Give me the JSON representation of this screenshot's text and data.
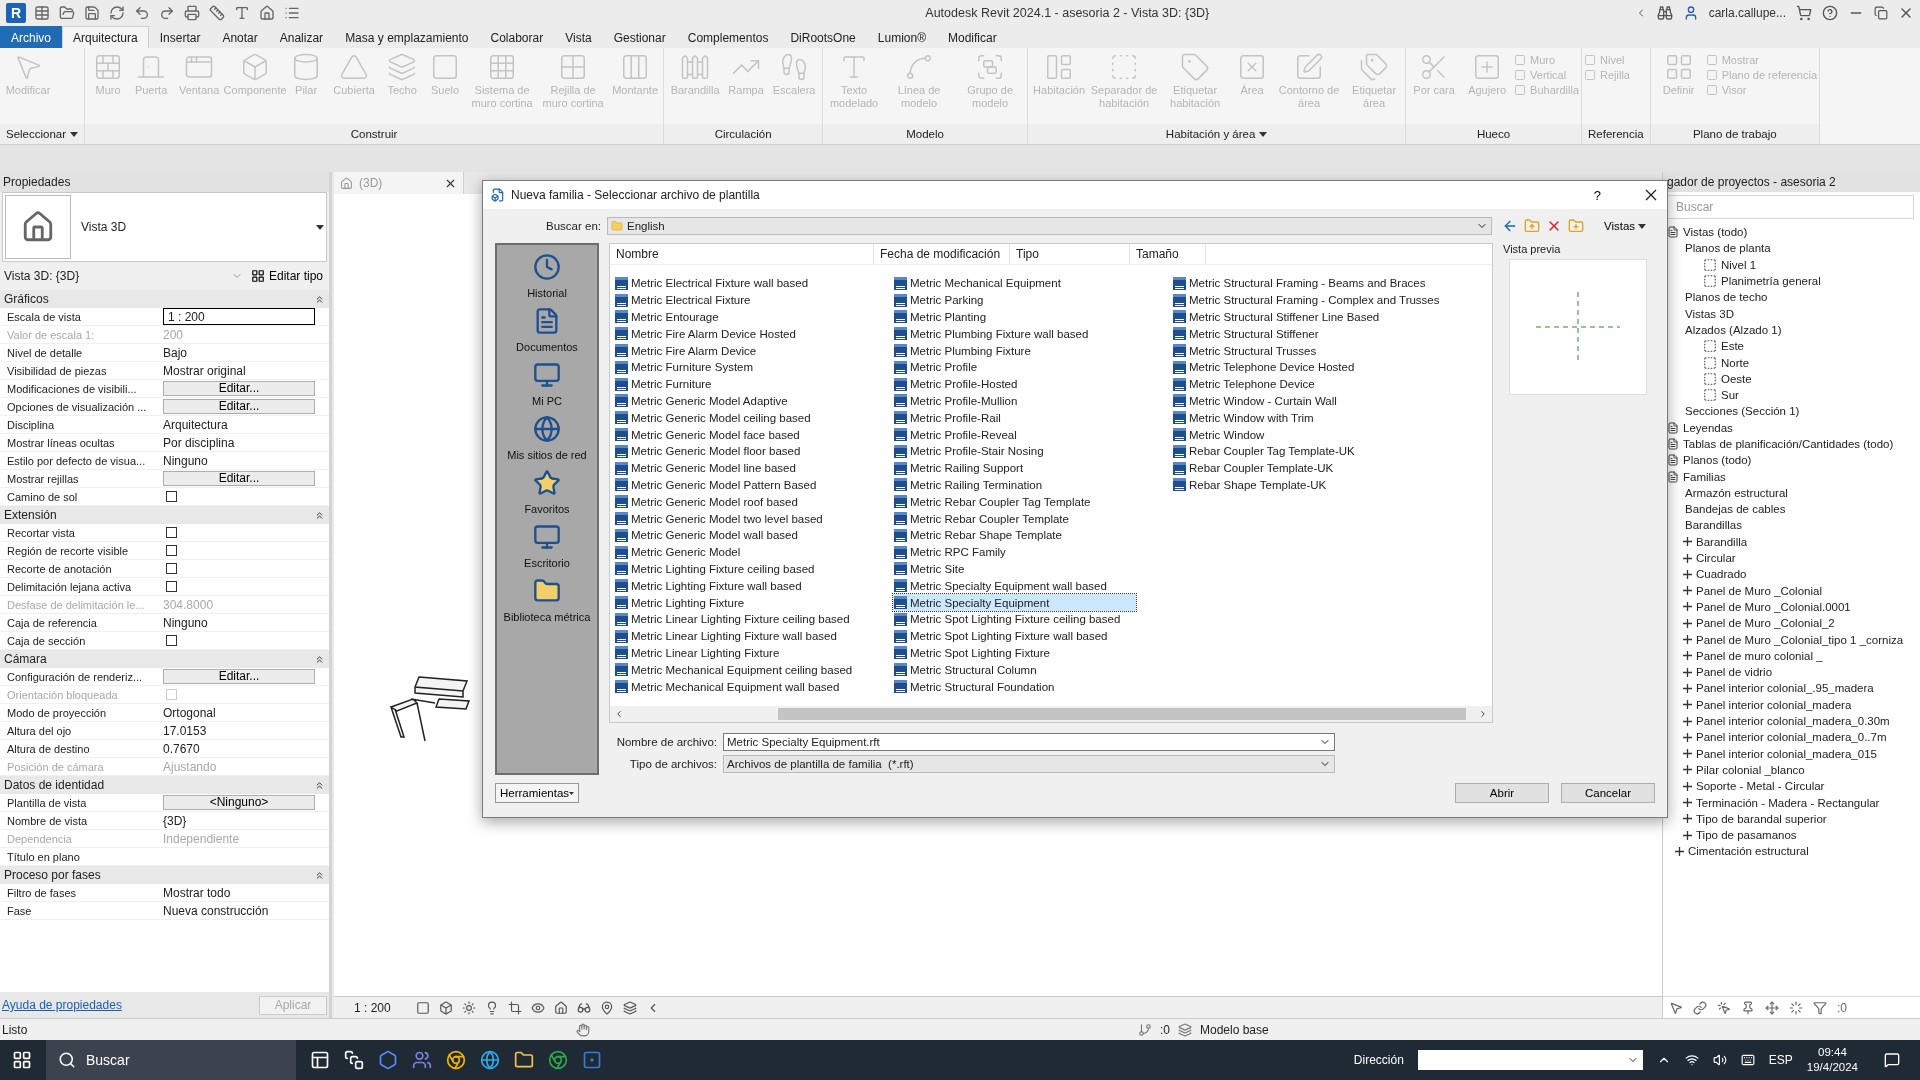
{
  "app": {
    "logo": "R",
    "title": "Autodesk Revit 2024.1 - asesoria 2 - Vista 3D: {3D}",
    "user": "carla.callupe..."
  },
  "menu": [
    {
      "label": "Archivo",
      "kind": "file",
      "selected": false
    },
    {
      "label": "Arquitectura",
      "kind": "tab",
      "selected": true
    },
    {
      "label": "Insertar",
      "kind": "tab",
      "selected": false
    },
    {
      "label": "Anotar",
      "kind": "tab",
      "selected": false
    },
    {
      "label": "Analizar",
      "kind": "tab",
      "selected": false
    },
    {
      "label": "Masa y emplazamiento",
      "kind": "tab",
      "selected": false
    },
    {
      "label": "Colaborar",
      "kind": "tab",
      "selected": false
    },
    {
      "label": "Vista",
      "kind": "tab",
      "selected": false
    },
    {
      "label": "Gestionar",
      "kind": "tab",
      "selected": false
    },
    {
      "label": "Complementos",
      "kind": "tab",
      "selected": false
    },
    {
      "label": "DiRootsOne",
      "kind": "tab",
      "selected": false
    },
    {
      "label": "Lumion®",
      "kind": "tab",
      "selected": false
    },
    {
      "label": "Modificar",
      "kind": "tab",
      "selected": false
    }
  ],
  "ribbon": [
    {
      "label": "Seleccionar",
      "has_menu": true,
      "tools": [
        {
          "kind": "large",
          "label": "Modificar",
          "disabled": true
        }
      ]
    },
    {
      "label": "Construir",
      "has_menu": false,
      "tools": [
        {
          "kind": "large",
          "label": "Muro",
          "disabled": true
        },
        {
          "kind": "large",
          "label": "Puerta",
          "disabled": true
        },
        {
          "kind": "large",
          "label": "Ventana",
          "disabled": true
        },
        {
          "kind": "large",
          "label": "Componente",
          "disabled": true
        },
        {
          "kind": "large",
          "label": "Pilar",
          "disabled": true
        },
        {
          "kind": "large",
          "label": "Cubierta",
          "disabled": true
        },
        {
          "kind": "large",
          "label": "Techo",
          "disabled": true
        },
        {
          "kind": "large",
          "label": "Suelo",
          "disabled": true
        },
        {
          "kind": "large",
          "label": "Sistema de muro cortina",
          "disabled": true
        },
        {
          "kind": "large",
          "label": "Rejilla de muro cortina",
          "disabled": true
        },
        {
          "kind": "large",
          "label": "Montante",
          "disabled": true
        }
      ]
    },
    {
      "label": "Circulación",
      "has_menu": false,
      "tools": [
        {
          "kind": "large",
          "label": "Barandilla",
          "disabled": true
        },
        {
          "kind": "large",
          "label": "Rampa",
          "disabled": true
        },
        {
          "kind": "large",
          "label": "Escalera",
          "disabled": true
        }
      ]
    },
    {
      "label": "Modelo",
      "has_menu": false,
      "tools": [
        {
          "kind": "large",
          "label": "Texto modelado",
          "disabled": true
        },
        {
          "kind": "large",
          "label": "Línea de modelo",
          "disabled": true
        },
        {
          "kind": "large",
          "label": "Grupo de modelo",
          "disabled": true
        }
      ]
    },
    {
      "label": "Habitación y área",
      "has_menu": true,
      "tools": [
        {
          "kind": "large",
          "label": "Habitación",
          "disabled": true
        },
        {
          "kind": "large",
          "label": "Separador de habitación",
          "disabled": true
        },
        {
          "kind": "large",
          "label": "Etiquetar habitación",
          "disabled": true
        },
        {
          "kind": "large",
          "label": "Área",
          "disabled": true
        },
        {
          "kind": "large",
          "label": "Contorno de área",
          "disabled": true
        },
        {
          "kind": "large",
          "label": "Etiquetar área",
          "disabled": true
        }
      ]
    },
    {
      "label": "Hueco",
      "has_menu": false,
      "tools": [
        {
          "kind": "large",
          "label": "Por cara",
          "disabled": true
        },
        {
          "kind": "large",
          "label": "Agujero",
          "disabled": true
        },
        {
          "kind": "stack",
          "items": [
            {
              "label": "Muro",
              "disabled": true
            },
            {
              "label": "Vertical",
              "disabled": true
            },
            {
              "label": "Buhardilla",
              "disabled": true
            }
          ]
        }
      ]
    },
    {
      "label": "Referencia",
      "has_menu": false,
      "tools": [
        {
          "kind": "stack",
          "items": [
            {
              "label": "Nivel",
              "disabled": true
            },
            {
              "label": "Rejilla",
              "disabled": true
            }
          ]
        }
      ]
    },
    {
      "label": "Plano de trabajo",
      "has_menu": false,
      "tools": [
        {
          "kind": "large",
          "label": "Definir",
          "disabled": true
        },
        {
          "kind": "stack",
          "items": [
            {
              "label": "Mostrar",
              "disabled": true
            },
            {
              "label": "Plano de referencia",
              "disabled": true
            },
            {
              "label": "Visor",
              "disabled": true
            }
          ]
        }
      ]
    }
  ],
  "properties": {
    "title": "Propiedades",
    "type_name": "Vista 3D",
    "instance": "Vista 3D: {3D}",
    "edit_type": "Editar tipo",
    "sections": [
      {
        "title": "Gráficos",
        "rows": [
          {
            "label": "Escala de vista",
            "value": "1 : 200",
            "kind": "input",
            "disabled": false
          },
          {
            "label": "Valor de escala 1:",
            "value": "200",
            "kind": "text",
            "disabled": true
          },
          {
            "label": "Nivel de detalle",
            "value": "Bajo",
            "kind": "text",
            "disabled": false
          },
          {
            "label": "Visibilidad de piezas",
            "value": "Mostrar original",
            "kind": "text",
            "disabled": false
          },
          {
            "label": "Modificaciones de visibili...",
            "value": "Editar...",
            "kind": "button",
            "disabled": false
          },
          {
            "label": "Opciones de visualización ...",
            "value": "Editar...",
            "kind": "button",
            "disabled": false
          },
          {
            "label": "Disciplina",
            "value": "Arquitectura",
            "kind": "text",
            "disabled": false
          },
          {
            "label": "Mostrar líneas ocultas",
            "value": "Por disciplina",
            "kind": "text",
            "disabled": false
          },
          {
            "label": "Estilo por defecto de visua...",
            "value": "Ninguno",
            "kind": "text",
            "disabled": false
          },
          {
            "label": "Mostrar rejillas",
            "value": "Editar...",
            "kind": "button",
            "disabled": false
          },
          {
            "label": "Camino de sol",
            "kind": "checkbox",
            "checked": false,
            "disabled": false
          }
        ]
      },
      {
        "title": "Extensión",
        "rows": [
          {
            "label": "Recortar vista",
            "kind": "checkbox",
            "checked": false,
            "disabled": false
          },
          {
            "label": "Región de recorte visible",
            "kind": "checkbox",
            "checked": false,
            "disabled": false
          },
          {
            "label": "Recorte de anotación",
            "kind": "checkbox",
            "checked": false,
            "disabled": false
          },
          {
            "label": "Delimitación lejana activa",
            "kind": "checkbox",
            "checked": false,
            "disabled": false
          },
          {
            "label": "Desfase de delimitación le...",
            "value": "304.8000",
            "kind": "text",
            "disabled": true
          },
          {
            "label": "Caja de referencia",
            "value": "Ninguno",
            "kind": "text",
            "disabled": false
          },
          {
            "label": "Caja de sección",
            "kind": "checkbox",
            "checked": false,
            "disabled": false
          }
        ]
      },
      {
        "title": "Cámara",
        "rows": [
          {
            "label": "Configuración de renderiz...",
            "value": "Editar...",
            "kind": "button",
            "disabled": false
          },
          {
            "label": "Orientación bloqueada",
            "kind": "checkbox",
            "checked": false,
            "disabled": true
          },
          {
            "label": "Modo de proyección",
            "value": "Ortogonal",
            "kind": "text",
            "disabled": false
          },
          {
            "label": "Altura del ojo",
            "value": "17.0153",
            "kind": "text",
            "disabled": false
          },
          {
            "label": "Altura de destino",
            "value": "0.7670",
            "kind": "text",
            "disabled": false
          },
          {
            "label": "Posición de cámara",
            "value": "Ajustando",
            "kind": "text",
            "disabled": true
          }
        ]
      },
      {
        "title": "Datos de identidad",
        "rows": [
          {
            "label": "Plantilla de vista",
            "value": "<Ninguno>",
            "kind": "button",
            "disabled": false
          },
          {
            "label": "Nombre de vista",
            "value": "{3D}",
            "kind": "text",
            "disabled": false
          },
          {
            "label": "Dependencia",
            "value": "Independiente",
            "kind": "text",
            "disabled": true
          },
          {
            "label": "Título en plano",
            "kind": "text",
            "disabled": false
          }
        ]
      },
      {
        "title": "Proceso por fases",
        "rows": [
          {
            "label": "Filtro de fases",
            "value": "Mostrar todo",
            "kind": "text",
            "disabled": false
          },
          {
            "label": "Fase",
            "value": "Nueva construcción",
            "kind": "text",
            "disabled": false
          }
        ]
      }
    ],
    "help_link": "Ayuda de propiedades",
    "apply": {
      "label": "Aplicar",
      "disabled": true
    }
  },
  "view": {
    "tab": "(3D)",
    "scale": "1 : 200"
  },
  "browser": {
    "title": "gador de proyectos - asesoria 2",
    "search_placeholder": "Buscar",
    "tree": [
      {
        "label": "Vistas (todo)",
        "kind": "category",
        "children": [
          {
            "label": "Planos de planta",
            "kind": "folder",
            "children": [
              {
                "label": "Nivel 1",
                "kind": "view"
              },
              {
                "label": "Planimetría general",
                "kind": "view"
              }
            ]
          },
          {
            "label": "Planos de techo",
            "kind": "folder"
          },
          {
            "label": "Vistas 3D",
            "kind": "folder"
          },
          {
            "label": "Alzados (Alzado 1)",
            "kind": "folder",
            "children": [
              {
                "label": "Este",
                "kind": "view"
              },
              {
                "label": "Norte",
                "kind": "view"
              },
              {
                "label": "Oeste",
                "kind": "view"
              },
              {
                "label": "Sur",
                "kind": "view"
              }
            ]
          },
          {
            "label": "Secciones (Sección 1)",
            "kind": "folder"
          }
        ]
      },
      {
        "label": "Leyendas",
        "kind": "category"
      },
      {
        "label": "Tablas de planificación/Cantidades (todo)",
        "kind": "category"
      },
      {
        "label": "Planos (todo)",
        "kind": "category"
      },
      {
        "label": "Familias",
        "kind": "category",
        "children": [
          {
            "label": "Armazón estructural",
            "kind": "folder"
          },
          {
            "label": "Bandejas de cables",
            "kind": "folder"
          },
          {
            "label": "Barandillas",
            "kind": "folder",
            "children": [
              {
                "label": "Barandilla",
                "kind": "family",
                "expanded": false
              },
              {
                "label": "Circular",
                "kind": "family",
                "expanded": false
              },
              {
                "label": "Cuadrado",
                "kind": "family",
                "expanded": false
              },
              {
                "label": "Panel de Muro _Colonial",
                "kind": "family",
                "expanded": false
              },
              {
                "label": "Panel de Muro _Colonial.0001",
                "kind": "family",
                "expanded": false
              },
              {
                "label": "Panel de Muro _Colonial_2",
                "kind": "family",
                "expanded": false
              },
              {
                "label": "Panel de Muro _Colonial_tipo 1 _corniza",
                "kind": "family",
                "expanded": false
              },
              {
                "label": "Panel de muro colonial _",
                "kind": "family",
                "expanded": false
              },
              {
                "label": "Panel de vidrio",
                "kind": "family",
                "expanded": false
              },
              {
                "label": "Panel interior colonial_.95_madera",
                "kind": "family",
                "expanded": false
              },
              {
                "label": "Panel interior colonial_madera",
                "kind": "family",
                "expanded": false
              },
              {
                "label": "Panel interior colonial_madera_0.30m",
                "kind": "family",
                "expanded": false
              },
              {
                "label": "Panel interior colonial_madera_0..7m",
                "kind": "family",
                "expanded": false
              },
              {
                "label": "Panel interior colonial_madera_015",
                "kind": "family",
                "expanded": false
              },
              {
                "label": "Pilar colonial _blanco",
                "kind": "family",
                "expanded": false
              },
              {
                "label": "Soporte - Metal - Circular",
                "kind": "family",
                "expanded": false
              },
              {
                "label": "Terminación - Madera - Rectangular",
                "kind": "family",
                "expanded": false
              },
              {
                "label": "Tipo de barandal superior",
                "kind": "family",
                "expanded": false
              },
              {
                "label": "Tipo de pasamanos",
                "kind": "family",
                "expanded": false
              }
            ]
          },
          {
            "label": "Cimentación estructural",
            "kind": "family",
            "expanded": false
          }
        ]
      }
    ],
    "filter_count": ":0"
  },
  "status": {
    "text": "Listo",
    "count": ":0",
    "model": "Modelo base"
  },
  "dialog": {
    "title": "Nueva familia - Seleccionar archivo de plantilla",
    "help": "?",
    "look_in_label": "Buscar en:",
    "look_in": "English",
    "views": "Vistas",
    "places": [
      "Historial",
      "Documentos",
      "Mi PC",
      "Mis sitios de red",
      "Favoritos",
      "Escritorio",
      "Biblioteca métrica"
    ],
    "columns": [
      "Nombre",
      "Fecha de modificación",
      "Tipo",
      "Tamaño"
    ],
    "files": [
      {
        "name": "Metric Electrical Fixture wall based",
        "selected": false
      },
      {
        "name": "Metric Electrical Fixture",
        "selected": false
      },
      {
        "name": "Metric Entourage",
        "selected": false
      },
      {
        "name": "Metric Fire Alarm Device Hosted",
        "selected": false
      },
      {
        "name": "Metric Fire Alarm Device",
        "selected": false
      },
      {
        "name": "Metric Furniture System",
        "selected": false
      },
      {
        "name": "Metric Furniture",
        "selected": false
      },
      {
        "name": "Metric Generic Model Adaptive",
        "selected": false
      },
      {
        "name": "Metric Generic Model ceiling based",
        "selected": false
      },
      {
        "name": "Metric Generic Model face based",
        "selected": false
      },
      {
        "name": "Metric Generic Model floor based",
        "selected": false
      },
      {
        "name": "Metric Generic Model line based",
        "selected": false
      },
      {
        "name": "Metric Generic Model Pattern Based",
        "selected": false
      },
      {
        "name": "Metric Generic Model roof based",
        "selected": false
      },
      {
        "name": "Metric Generic Model two level based",
        "selected": false
      },
      {
        "name": "Metric Generic Model wall based",
        "selected": false
      },
      {
        "name": "Metric Generic Model",
        "selected": false
      },
      {
        "name": "Metric Lighting Fixture ceiling based",
        "selected": false
      },
      {
        "name": "Metric Lighting Fixture wall based",
        "selected": false
      },
      {
        "name": "Metric Lighting Fixture",
        "selected": false
      },
      {
        "name": "Metric Linear Lighting Fixture ceiling based",
        "selected": false
      },
      {
        "name": "Metric Linear Lighting Fixture wall based",
        "selected": false
      },
      {
        "name": "Metric Linear Lighting Fixture",
        "selected": false
      },
      {
        "name": "Metric Mechanical Equipment ceiling based",
        "selected": false
      },
      {
        "name": "Metric Mechanical Equipment wall based",
        "selected": false
      },
      {
        "name": "Metric Mechanical Equipment",
        "selected": false
      },
      {
        "name": "Metric Parking",
        "selected": false
      },
      {
        "name": "Metric Planting",
        "selected": false
      },
      {
        "name": "Metric Plumbing Fixture wall based",
        "selected": false
      },
      {
        "name": "Metric Plumbing Fixture",
        "selected": false
      },
      {
        "name": "Metric Profile",
        "selected": false
      },
      {
        "name": "Metric Profile-Hosted",
        "selected": false
      },
      {
        "name": "Metric Profile-Mullion",
        "selected": false
      },
      {
        "name": "Metric Profile-Rail",
        "selected": false
      },
      {
        "name": "Metric Profile-Reveal",
        "selected": false
      },
      {
        "name": "Metric Profile-Stair Nosing",
        "selected": false
      },
      {
        "name": "Metric Railing Support",
        "selected": false
      },
      {
        "name": "Metric Railing Termination",
        "selected": false
      },
      {
        "name": "Metric Rebar Coupler Tag Template",
        "selected": false
      },
      {
        "name": "Metric Rebar Coupler Template",
        "selected": false
      },
      {
        "name": "Metric Rebar Shape Template",
        "selected": false
      },
      {
        "name": "Metric RPC Family",
        "selected": false
      },
      {
        "name": "Metric Site",
        "selected": false
      },
      {
        "name": "Metric Specialty Equipment wall based",
        "selected": false
      },
      {
        "name": "Metric Specialty Equipment",
        "selected": true
      },
      {
        "name": "Metric Spot Lighting Fixture ceiling based",
        "selected": false
      },
      {
        "name": "Metric Spot Lighting Fixture wall based",
        "selected": false
      },
      {
        "name": "Metric Spot Lighting Fixture",
        "selected": false
      },
      {
        "name": "Metric Structural Column",
        "selected": false
      },
      {
        "name": "Metric Structural Foundation",
        "selected": false
      },
      {
        "name": "Metric Structural Framing - Beams and Braces",
        "selected": false
      },
      {
        "name": "Metric Structural Framing - Complex and Trusses",
        "selected": false
      },
      {
        "name": "Metric Structural Stiffener Line Based",
        "selected": false
      },
      {
        "name": "Metric Structural Stiffener",
        "selected": false
      },
      {
        "name": "Metric Structural Trusses",
        "selected": false
      },
      {
        "name": "Metric Telephone Device Hosted",
        "selected": false
      },
      {
        "name": "Metric Telephone Device",
        "selected": false
      },
      {
        "name": "Metric Window - Curtain Wall",
        "selected": false
      },
      {
        "name": "Metric Window with Trim",
        "selected": false
      },
      {
        "name": "Metric Window",
        "selected": false
      },
      {
        "name": "Rebar Coupler Tag Template-UK",
        "selected": false
      },
      {
        "name": "Rebar Coupler Template-UK",
        "selected": false
      },
      {
        "name": "Rebar Shape Template-UK",
        "selected": false
      }
    ],
    "preview_label": "Vista previa",
    "filename_label": "Nombre de archivo:",
    "filename": "Metric Specialty Equipment.rft",
    "filetype_label": "Tipo de archivos:",
    "filetype": "Archivos de plantilla de familia  (*.rft)",
    "tools": "Herramientas",
    "open": "Abrir",
    "cancel": "Cancelar"
  },
  "taskbar": {
    "search": "Buscar",
    "address_label": "Dirección",
    "lang": "ESP",
    "time": "09:44",
    "date": "19/4/2024"
  }
}
